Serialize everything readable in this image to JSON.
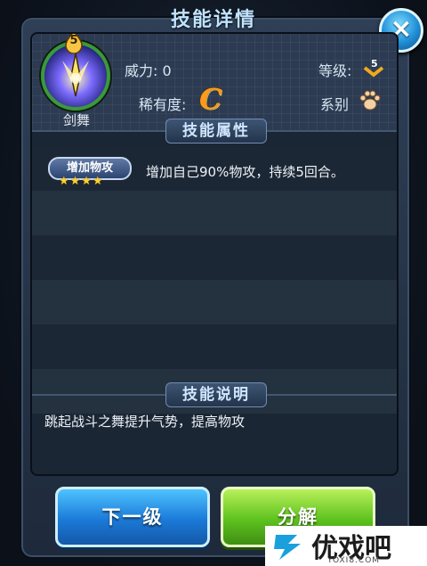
{
  "dialog": {
    "title": "技能详情",
    "close_label": "×"
  },
  "skill": {
    "level": "5",
    "name": "剑舞",
    "power_label": "威力: 0",
    "grade_label": "等级:",
    "grade_value": "5",
    "rarity_label": "稀有度:",
    "rarity_value": "C",
    "series_label": "系别"
  },
  "sections": {
    "attributes_title": "技能属性",
    "description_title": "技能说明"
  },
  "effects": [
    {
      "badge": "增加物攻",
      "stars": "★★★★",
      "star_count": 4,
      "text": "增加自己90%物攻，持续5回合。"
    }
  ],
  "description": "跳起战斗之舞提升气势，提高物攻",
  "buttons": {
    "next_level": "下一级",
    "decompose": "分解"
  },
  "watermark": {
    "name": "优戏吧",
    "url": "YOXI8.COM"
  },
  "colors": {
    "rarity": "#ff9a1a",
    "next_button": "#1b7ad8",
    "decompose_button": "#5ec21e",
    "stars": "#ffd12a"
  }
}
